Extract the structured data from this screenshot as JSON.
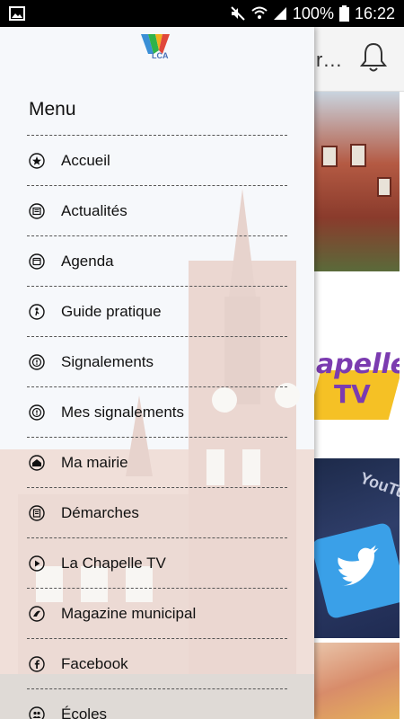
{
  "status_bar": {
    "battery": "100%",
    "time": "16:22"
  },
  "header": {
    "title_fragment": "r…"
  },
  "drawer": {
    "brand_text": "LCA",
    "menu_title": "Menu",
    "items": [
      {
        "label": "Accueil",
        "icon": "star-icon"
      },
      {
        "label": "Actualités",
        "icon": "news-icon"
      },
      {
        "label": "Agenda",
        "icon": "calendar-icon"
      },
      {
        "label": "Guide pratique",
        "icon": "guide-icon"
      },
      {
        "label": "Signalements",
        "icon": "alert-icon"
      },
      {
        "label": "Mes signalements",
        "icon": "alert-icon"
      },
      {
        "label": "Ma mairie",
        "icon": "town-hall-icon"
      },
      {
        "label": "Démarches",
        "icon": "form-icon"
      },
      {
        "label": "La Chapelle TV",
        "icon": "play-icon"
      },
      {
        "label": "Magazine municipal",
        "icon": "magazine-icon"
      },
      {
        "label": "Facebook",
        "icon": "facebook-icon"
      },
      {
        "label": "Écoles",
        "icon": "school-icon"
      }
    ]
  },
  "cards": {
    "tv_logo_line1": "apelle",
    "tv_logo_line2": "TV",
    "social_label": "YouTu"
  },
  "colors": {
    "status_bar": "#000000",
    "drawer_background": "#eef1f5",
    "divider": "#555555",
    "text": "#111111",
    "tv_purple": "#7b3bb0",
    "tv_yellow": "#f5c125",
    "twitter_blue": "#3aa0e8"
  }
}
